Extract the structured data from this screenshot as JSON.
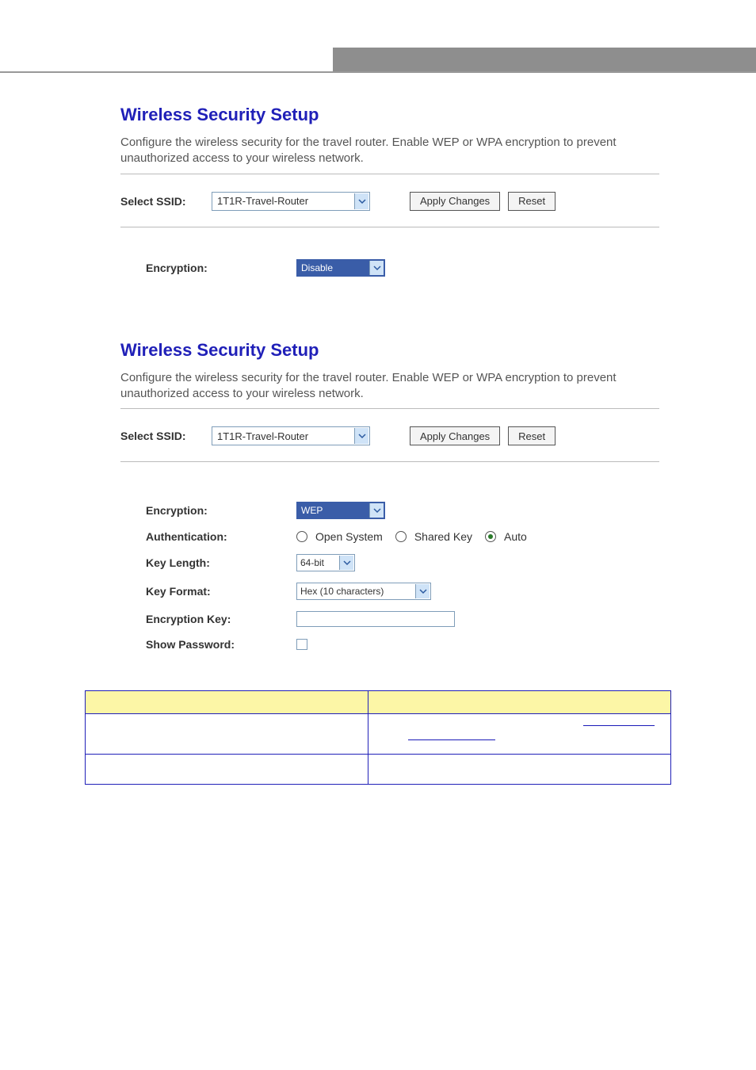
{
  "page_title": "Wireless Security Setup",
  "description": "Configure the wireless security for the travel router. Enable WEP or WPA encryption to prevent unauthorized access to your wireless network.",
  "ssid_label": "Select SSID:",
  "ssid_value": "1T1R-Travel-Router",
  "apply_label": "Apply Changes",
  "reset_label": "Reset",
  "section1": {
    "encryption_label": "Encryption:",
    "encryption_value": "Disable"
  },
  "section2": {
    "encryption_label": "Encryption:",
    "encryption_value": "WEP",
    "auth_label": "Authentication:",
    "auth_options": {
      "open": "Open System",
      "shared": "Shared Key",
      "auto": "Auto"
    },
    "auth_selected": "auto",
    "keylen_label": "Key Length:",
    "keylen_value": "64-bit",
    "keyfmt_label": "Key Format:",
    "keyfmt_value": "Hex (10 characters)",
    "enckey_label": "Encryption Key:",
    "showpw_label": "Show Password:"
  }
}
